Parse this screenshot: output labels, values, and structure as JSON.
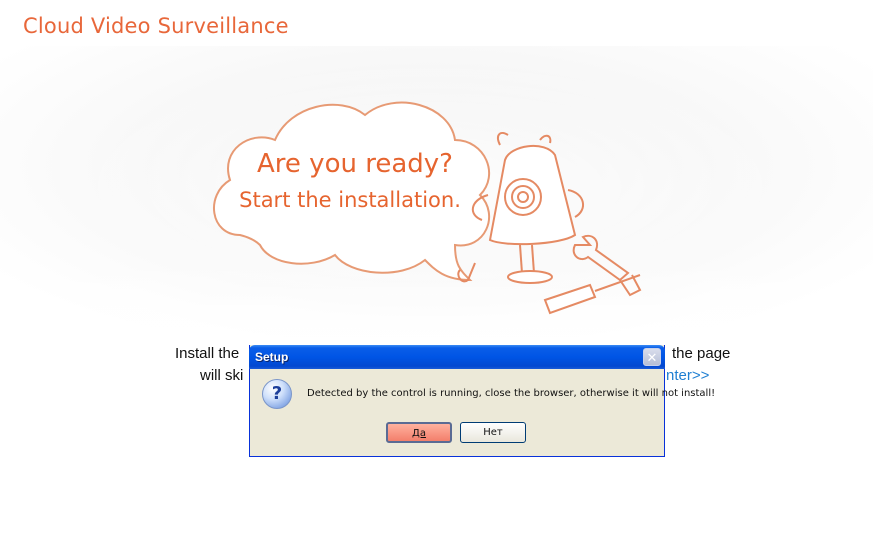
{
  "page": {
    "title": "Cloud Video Surveillance"
  },
  "hero": {
    "line1": "Are you ready?",
    "line2": "Start the installation."
  },
  "install": {
    "line1_left": "Install the",
    "line1_right": "the page",
    "line2_left": "will ski",
    "link_text": "nter>>"
  },
  "dialog": {
    "title": "Setup",
    "close_symbol": "✕",
    "icon_symbol": "?",
    "message": "Detected by the control is running, close the browser, otherwise it will not install!",
    "yes_label": "Да",
    "no_label": "Нет"
  },
  "colors": {
    "brand": "#e8673a",
    "link": "#1f7fd2",
    "titlebar": "#0055e5",
    "dialog_bg": "#ece9d8"
  }
}
